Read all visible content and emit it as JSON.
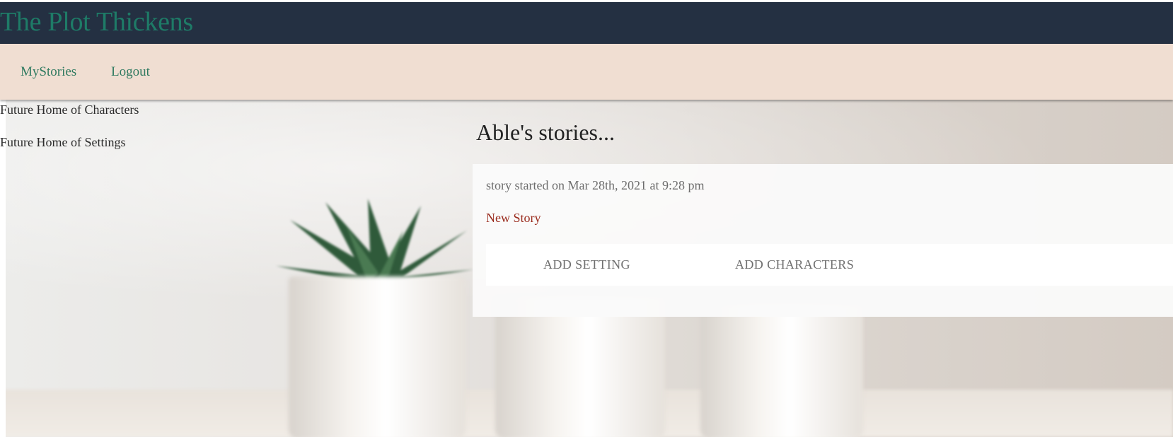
{
  "header": {
    "title": "The Plot Thickens",
    "background_color": "#243042",
    "title_color": "#1e7b67"
  },
  "nav": {
    "background_color": "#f0ded2",
    "link_color": "#2f7a60",
    "items": [
      {
        "label": "MyStories"
      },
      {
        "label": "Logout"
      }
    ]
  },
  "sidebar": {
    "items": [
      {
        "label": "Future Home of Characters"
      },
      {
        "label": "Future Home of Settings"
      }
    ]
  },
  "main": {
    "heading": "Able's stories...",
    "stories": [
      {
        "date_text": "story started on Mar 28th, 2021 at 9:28 pm",
        "title": "New Story",
        "title_color": "#9a2b1d",
        "actions": [
          {
            "label": "ADD SETTING"
          },
          {
            "label": "ADD CHARACTERS"
          }
        ]
      }
    ]
  },
  "background_image": {
    "icon": "blurred-potted-plants-photo"
  }
}
